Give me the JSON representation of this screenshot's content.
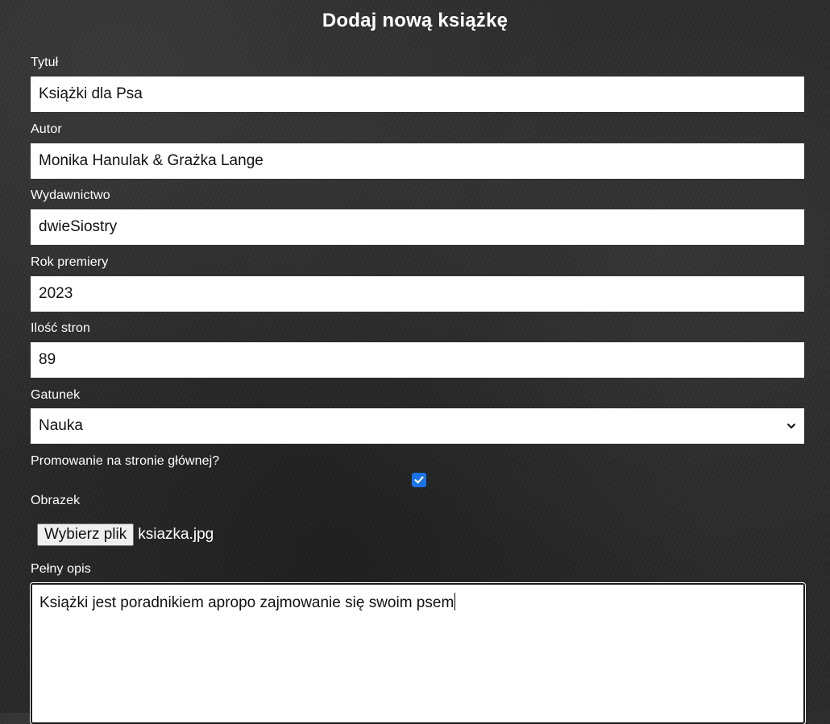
{
  "form": {
    "title": "Dodaj nową książkę",
    "fields": {
      "title": {
        "label": "Tytuł",
        "value": "Książki dla Psa"
      },
      "author": {
        "label": "Autor",
        "value": "Monika Hanulak & Grażka Lange"
      },
      "publisher": {
        "label": "Wydawnictwo",
        "value": "dwieSiostry"
      },
      "year": {
        "label": "Rok premiery",
        "value": "2023"
      },
      "pages": {
        "label": "Ilość stron",
        "value": "89"
      },
      "genre": {
        "label": "Gatunek",
        "selected": "Nauka",
        "icon": "chevron-down-icon"
      },
      "promote": {
        "label": "Promowanie na stronie głównej?",
        "checked": true,
        "icon": "checkmark-icon",
        "color": "#1a73e8"
      },
      "image": {
        "label": "Obrazek",
        "button_label": "Wybierz plik",
        "file_name": "ksiazka.jpg"
      },
      "description": {
        "label": "Pełny opis",
        "value": "Książki jest poradnikiem apropo zajmowanie się swoim psem"
      }
    }
  },
  "colors": {
    "background": "#2a2a2a",
    "text": "#ffffff",
    "input_background": "#ffffff",
    "checkbox_accent": "#1a73e8"
  }
}
